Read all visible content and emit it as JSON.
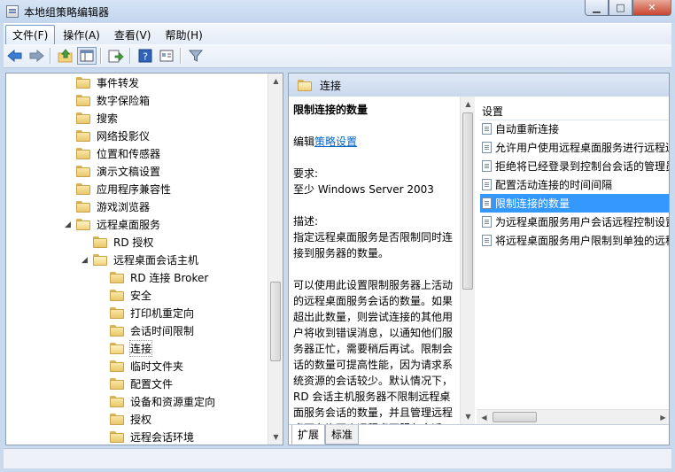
{
  "window": {
    "title": "本地组策略编辑器"
  },
  "menu": [
    "文件(F)",
    "操作(A)",
    "查看(V)",
    "帮助(H)"
  ],
  "tree": [
    {
      "label": "事件转发"
    },
    {
      "label": "数字保险箱"
    },
    {
      "label": "搜索"
    },
    {
      "label": "网络投影仪"
    },
    {
      "label": "位置和传感器"
    },
    {
      "label": "演示文稿设置"
    },
    {
      "label": "应用程序兼容性"
    },
    {
      "label": "游戏浏览器"
    },
    {
      "label": "远程桌面服务"
    },
    {
      "label": "RD 授权"
    },
    {
      "label": "远程桌面会话主机"
    },
    {
      "label": "RD 连接 Broker"
    },
    {
      "label": "安全"
    },
    {
      "label": "打印机重定向"
    },
    {
      "label": "会话时间限制"
    },
    {
      "label": "连接"
    },
    {
      "label": "临时文件夹"
    },
    {
      "label": "配置文件"
    },
    {
      "label": "设备和资源重定向"
    },
    {
      "label": "授权"
    },
    {
      "label": "远程会话环境"
    }
  ],
  "right": {
    "header": "连接",
    "policy_title": "限制连接的数量",
    "edit_prefix": "编辑",
    "edit_link": "策略设置",
    "req_label": "要求:",
    "req_value": "至少 Windows Server 2003",
    "desc_label": "描述:",
    "desc_1": "指定远程桌面服务是否限制同时连接到服务器的数量。",
    "desc_2": "可以使用此设置限制服务器上活动的远程桌面服务会话的数量。如果超出此数量，则尝试连接的其他用户将收到错误消息，以通知他们服务器正忙，需要稍后再试。限制会话的数量可提高性能，因为请求系统资源的会话较少。默认情况下，RD 会话主机服务器不限制远程桌面服务会话的数量，并且管理远程桌面允许两个远程桌面服务会话。",
    "settings_header": "设置",
    "settings": [
      "自动重新连接",
      "允许用户使用远程桌面服务进行远程连接",
      "拒绝将已经登录到控制台会话的管理员注销",
      "配置活动连接的时间间隔",
      "限制连接的数量",
      "为远程桌面服务用户会话远程控制设置规则",
      "将远程桌面服务用户限制到单独的远程桌面服务会话"
    ],
    "tabs": [
      "扩展",
      "标准"
    ]
  }
}
